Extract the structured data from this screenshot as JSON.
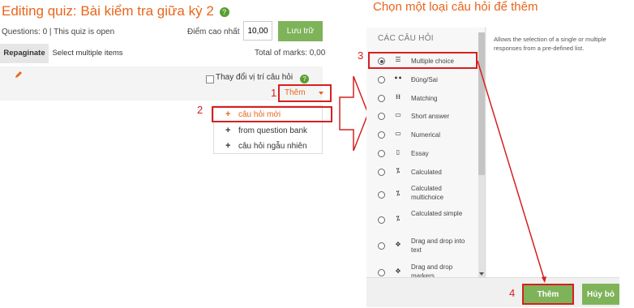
{
  "quiz": {
    "title": "Editing quiz: Bài kiểm tra giữa kỳ 2",
    "status": "Questions: 0 | This quiz is open",
    "max_grade_label": "Điểm cao nhất",
    "max_grade_value": "10,00",
    "save_label": "Lưu trữ",
    "repaginate_label": "Repaginate",
    "select_multiple_label": "Select multiple items",
    "total_marks": "Total of marks: 0,00",
    "shuffle_label": "Thay đổi vị trí câu hỏi",
    "add_label": "Thêm",
    "add_menu_items": [
      "câu hỏi mới",
      "from question bank",
      "câu hỏi ngẫu nhiên"
    ]
  },
  "annotations": {
    "step1": "1",
    "step2": "2",
    "step3": "3",
    "step4": "4"
  },
  "dialog": {
    "title": "Chọn một loại câu hỏi để thêm",
    "list_heading": "CÁC CÂU HỎI",
    "description": "Allows the selection of a single or multiple responses from a pre-defined list.",
    "question_types": [
      {
        "label": "Multiple choice",
        "icon": "list-bullets-icon",
        "selected": true
      },
      {
        "label": "Đúng/Sai",
        "icon": "dots-icon",
        "selected": false
      },
      {
        "label": "Matching",
        "icon": "grid-icon",
        "selected": false
      },
      {
        "label": "Short answer",
        "icon": "dash-icon",
        "selected": false
      },
      {
        "label": "Numerical",
        "icon": "input-box-icon",
        "selected": false
      },
      {
        "label": "Essay",
        "icon": "page-icon",
        "selected": false
      },
      {
        "label": "Calculated",
        "icon": "calc-icon",
        "selected": false
      },
      {
        "label": "Calculated multichoice",
        "icon": "calc-multi-icon",
        "selected": false
      },
      {
        "label": "Calculated simple",
        "icon": "calc-simple-icon",
        "selected": false
      },
      {
        "label": "Drag and drop into text",
        "icon": "move-icon",
        "selected": false
      },
      {
        "label": "Drag and drop markers",
        "icon": "move-icon",
        "selected": false
      }
    ],
    "add_button": "Thêm",
    "cancel_button": "Hủy bỏ"
  },
  "colors": {
    "accent_orange": "#e8651a",
    "button_green": "#7fb35a",
    "highlight_red": "#d62020"
  }
}
